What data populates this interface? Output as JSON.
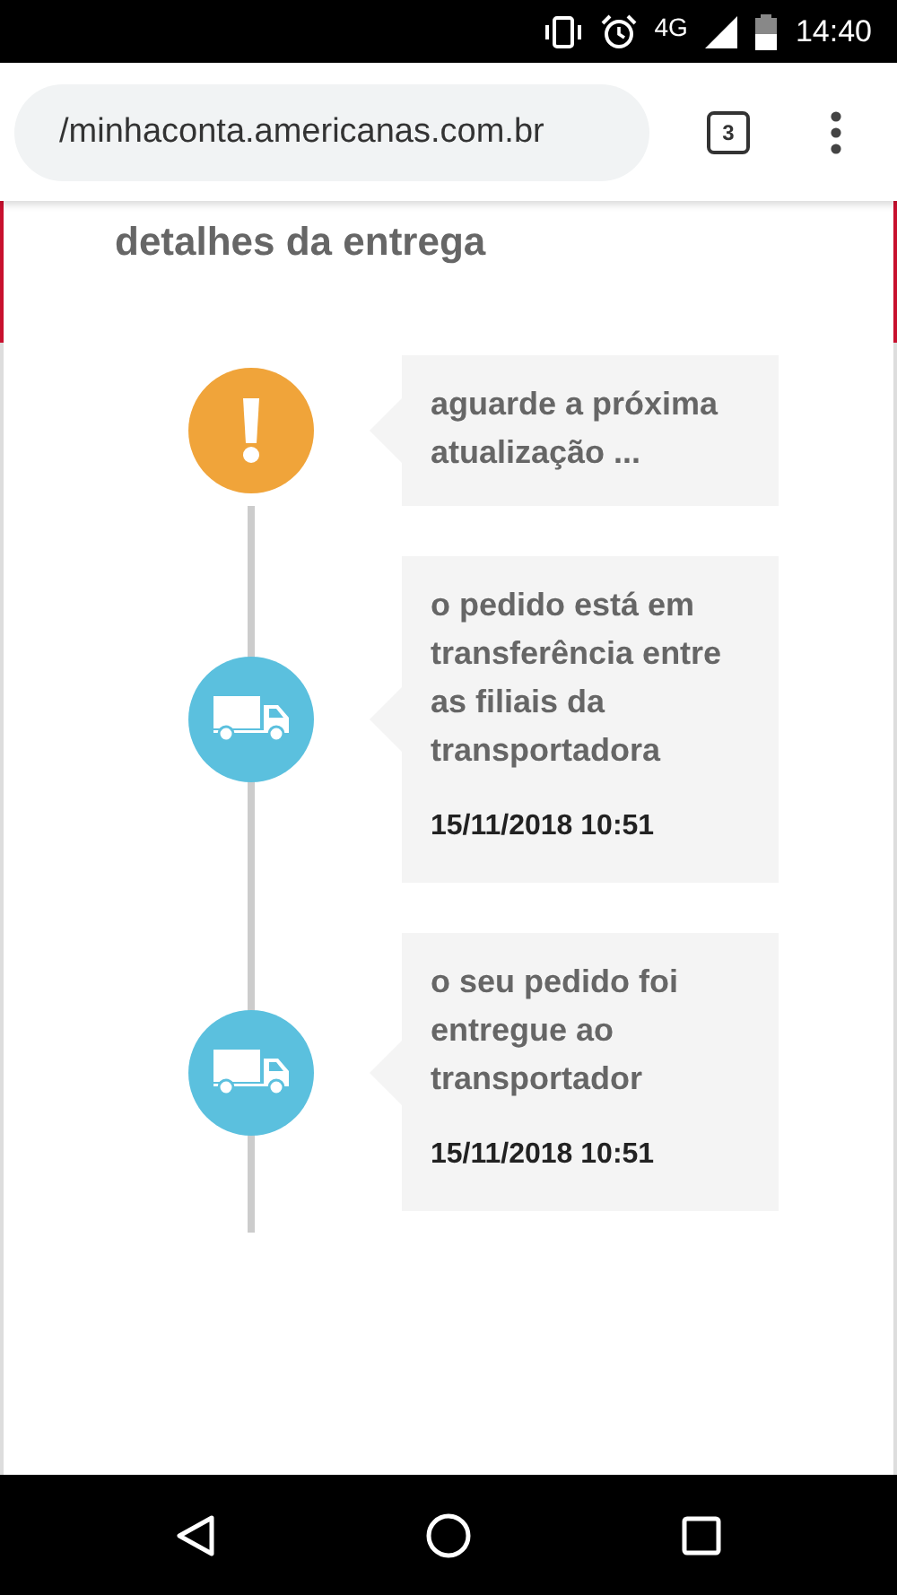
{
  "status_bar": {
    "network": "4G",
    "time": "14:40"
  },
  "browser": {
    "url": "/minhaconta.americanas.com.br",
    "tab_count": "3"
  },
  "section_title": "detalhes da entrega",
  "timeline": [
    {
      "kind": "alert",
      "color": "#f0a43a",
      "text": "aguarde a próxima atualização ..."
    },
    {
      "kind": "truck",
      "color": "#5bc0de",
      "text": "o pedido está em transferência entre as filiais da transportadora",
      "datetime": "15/11/2018 10:51"
    },
    {
      "kind": "truck",
      "color": "#5bc0de",
      "text": "o seu pedido foi entregue ao transportador",
      "datetime": "15/11/2018 10:51"
    }
  ]
}
